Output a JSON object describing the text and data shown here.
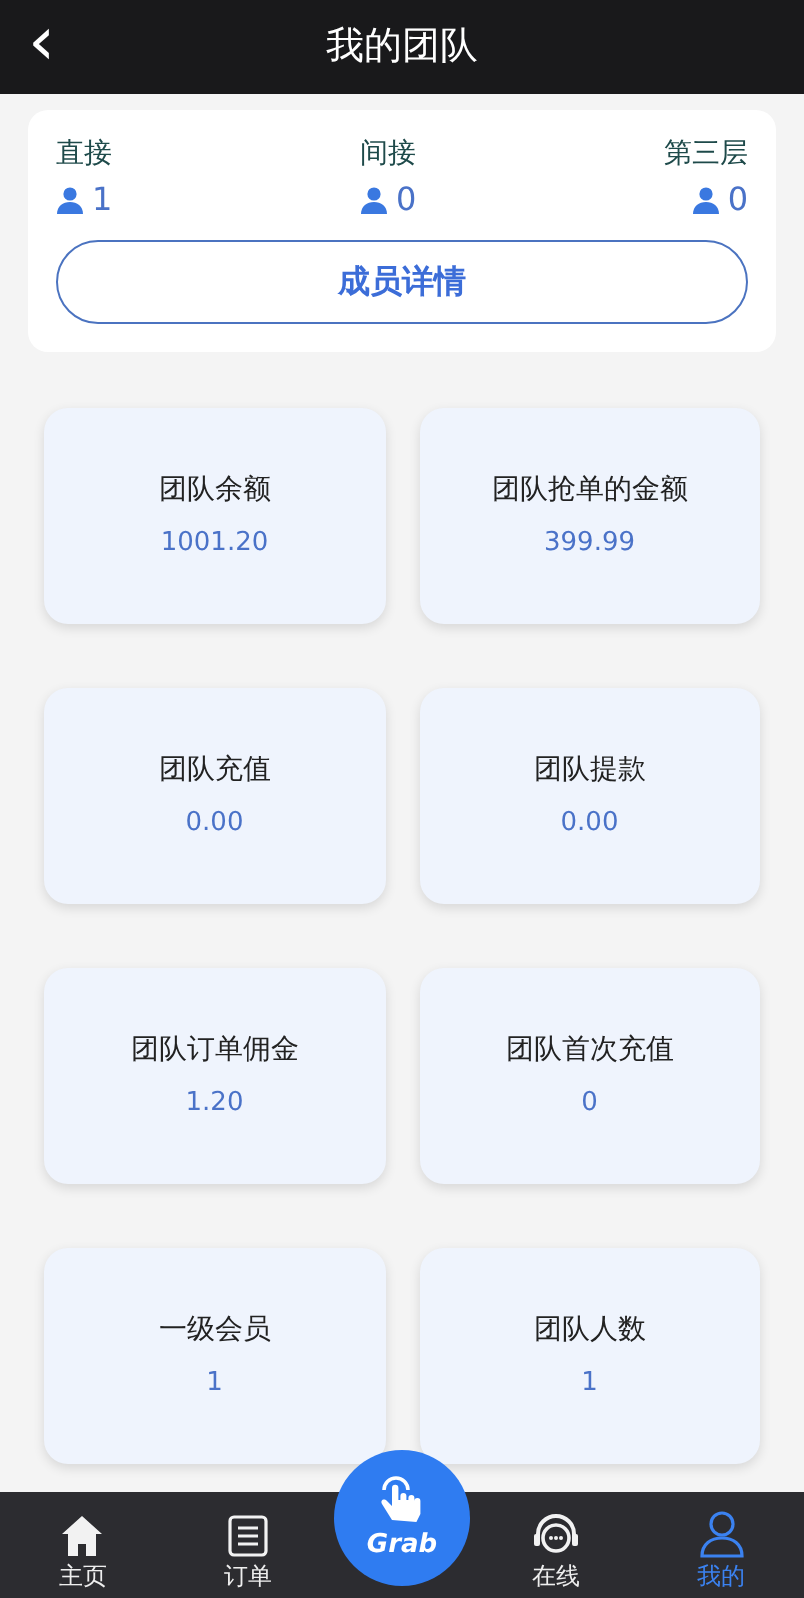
{
  "header": {
    "back_icon": "‹",
    "title": "我的团队"
  },
  "levels": [
    {
      "label": "直接",
      "count": "1"
    },
    {
      "label": "间接",
      "count": "0"
    },
    {
      "label": "第三层",
      "count": "0"
    }
  ],
  "details_button": "成员详情",
  "stats": [
    {
      "label": "团队余额",
      "value": "1001.20"
    },
    {
      "label": "团队抢单的金额",
      "value": "399.99"
    },
    {
      "label": "团队充值",
      "value": "0.00"
    },
    {
      "label": "团队提款",
      "value": "0.00"
    },
    {
      "label": "团队订单佣金",
      "value": "1.20"
    },
    {
      "label": "团队首次充值",
      "value": "0"
    },
    {
      "label": "一级会员",
      "value": "1"
    },
    {
      "label": "团队人数",
      "value": "1"
    }
  ],
  "tab_bar": [
    {
      "kind": "home",
      "label": "主页",
      "selected": false
    },
    {
      "kind": "orders",
      "label": "订单",
      "selected": false
    },
    {
      "kind": "grab",
      "label": "Grab",
      "selected": false
    },
    {
      "kind": "online",
      "label": "在线",
      "selected": false
    },
    {
      "kind": "mine",
      "label": "我的",
      "selected": true
    }
  ]
}
